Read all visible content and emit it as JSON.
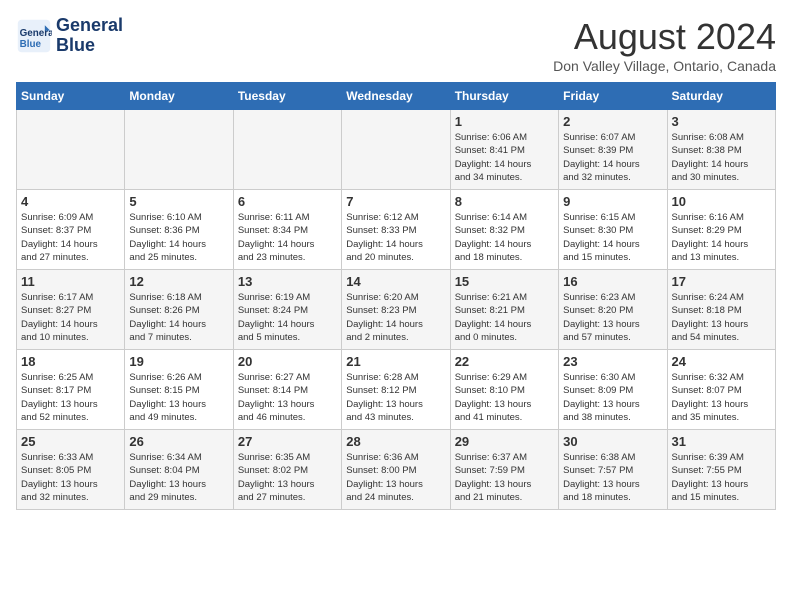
{
  "logo": {
    "line1": "General",
    "line2": "Blue"
  },
  "title": "August 2024",
  "location": "Don Valley Village, Ontario, Canada",
  "days_of_week": [
    "Sunday",
    "Monday",
    "Tuesday",
    "Wednesday",
    "Thursday",
    "Friday",
    "Saturday"
  ],
  "weeks": [
    [
      {
        "day": "",
        "info": ""
      },
      {
        "day": "",
        "info": ""
      },
      {
        "day": "",
        "info": ""
      },
      {
        "day": "",
        "info": ""
      },
      {
        "day": "1",
        "info": "Sunrise: 6:06 AM\nSunset: 8:41 PM\nDaylight: 14 hours\nand 34 minutes."
      },
      {
        "day": "2",
        "info": "Sunrise: 6:07 AM\nSunset: 8:39 PM\nDaylight: 14 hours\nand 32 minutes."
      },
      {
        "day": "3",
        "info": "Sunrise: 6:08 AM\nSunset: 8:38 PM\nDaylight: 14 hours\nand 30 minutes."
      }
    ],
    [
      {
        "day": "4",
        "info": "Sunrise: 6:09 AM\nSunset: 8:37 PM\nDaylight: 14 hours\nand 27 minutes."
      },
      {
        "day": "5",
        "info": "Sunrise: 6:10 AM\nSunset: 8:36 PM\nDaylight: 14 hours\nand 25 minutes."
      },
      {
        "day": "6",
        "info": "Sunrise: 6:11 AM\nSunset: 8:34 PM\nDaylight: 14 hours\nand 23 minutes."
      },
      {
        "day": "7",
        "info": "Sunrise: 6:12 AM\nSunset: 8:33 PM\nDaylight: 14 hours\nand 20 minutes."
      },
      {
        "day": "8",
        "info": "Sunrise: 6:14 AM\nSunset: 8:32 PM\nDaylight: 14 hours\nand 18 minutes."
      },
      {
        "day": "9",
        "info": "Sunrise: 6:15 AM\nSunset: 8:30 PM\nDaylight: 14 hours\nand 15 minutes."
      },
      {
        "day": "10",
        "info": "Sunrise: 6:16 AM\nSunset: 8:29 PM\nDaylight: 14 hours\nand 13 minutes."
      }
    ],
    [
      {
        "day": "11",
        "info": "Sunrise: 6:17 AM\nSunset: 8:27 PM\nDaylight: 14 hours\nand 10 minutes."
      },
      {
        "day": "12",
        "info": "Sunrise: 6:18 AM\nSunset: 8:26 PM\nDaylight: 14 hours\nand 7 minutes."
      },
      {
        "day": "13",
        "info": "Sunrise: 6:19 AM\nSunset: 8:24 PM\nDaylight: 14 hours\nand 5 minutes."
      },
      {
        "day": "14",
        "info": "Sunrise: 6:20 AM\nSunset: 8:23 PM\nDaylight: 14 hours\nand 2 minutes."
      },
      {
        "day": "15",
        "info": "Sunrise: 6:21 AM\nSunset: 8:21 PM\nDaylight: 14 hours\nand 0 minutes."
      },
      {
        "day": "16",
        "info": "Sunrise: 6:23 AM\nSunset: 8:20 PM\nDaylight: 13 hours\nand 57 minutes."
      },
      {
        "day": "17",
        "info": "Sunrise: 6:24 AM\nSunset: 8:18 PM\nDaylight: 13 hours\nand 54 minutes."
      }
    ],
    [
      {
        "day": "18",
        "info": "Sunrise: 6:25 AM\nSunset: 8:17 PM\nDaylight: 13 hours\nand 52 minutes."
      },
      {
        "day": "19",
        "info": "Sunrise: 6:26 AM\nSunset: 8:15 PM\nDaylight: 13 hours\nand 49 minutes."
      },
      {
        "day": "20",
        "info": "Sunrise: 6:27 AM\nSunset: 8:14 PM\nDaylight: 13 hours\nand 46 minutes."
      },
      {
        "day": "21",
        "info": "Sunrise: 6:28 AM\nSunset: 8:12 PM\nDaylight: 13 hours\nand 43 minutes."
      },
      {
        "day": "22",
        "info": "Sunrise: 6:29 AM\nSunset: 8:10 PM\nDaylight: 13 hours\nand 41 minutes."
      },
      {
        "day": "23",
        "info": "Sunrise: 6:30 AM\nSunset: 8:09 PM\nDaylight: 13 hours\nand 38 minutes."
      },
      {
        "day": "24",
        "info": "Sunrise: 6:32 AM\nSunset: 8:07 PM\nDaylight: 13 hours\nand 35 minutes."
      }
    ],
    [
      {
        "day": "25",
        "info": "Sunrise: 6:33 AM\nSunset: 8:05 PM\nDaylight: 13 hours\nand 32 minutes."
      },
      {
        "day": "26",
        "info": "Sunrise: 6:34 AM\nSunset: 8:04 PM\nDaylight: 13 hours\nand 29 minutes."
      },
      {
        "day": "27",
        "info": "Sunrise: 6:35 AM\nSunset: 8:02 PM\nDaylight: 13 hours\nand 27 minutes."
      },
      {
        "day": "28",
        "info": "Sunrise: 6:36 AM\nSunset: 8:00 PM\nDaylight: 13 hours\nand 24 minutes."
      },
      {
        "day": "29",
        "info": "Sunrise: 6:37 AM\nSunset: 7:59 PM\nDaylight: 13 hours\nand 21 minutes."
      },
      {
        "day": "30",
        "info": "Sunrise: 6:38 AM\nSunset: 7:57 PM\nDaylight: 13 hours\nand 18 minutes."
      },
      {
        "day": "31",
        "info": "Sunrise: 6:39 AM\nSunset: 7:55 PM\nDaylight: 13 hours\nand 15 minutes."
      }
    ]
  ]
}
